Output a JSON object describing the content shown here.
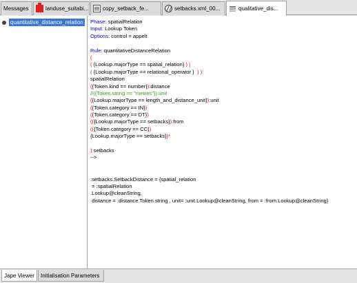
{
  "tabs": [
    {
      "label": "Messages",
      "icon": "none"
    },
    {
      "label": "landuse_suitabi...",
      "icon": "landuse-icon"
    },
    {
      "label": "copy_setback_fe...",
      "icon": "document-icon"
    },
    {
      "label": "setbacks.xml_00...",
      "icon": "xml-icon"
    },
    {
      "label": "qualitative_dis...",
      "icon": "jape-icon"
    }
  ],
  "tree": {
    "items": [
      {
        "label": "quantitative_distance_relation"
      }
    ]
  },
  "code_lines": [
    [
      {
        "t": "Phase: ",
        "c": "kw"
      },
      {
        "t": "spatialRelation",
        "c": "tx"
      }
    ],
    [
      {
        "t": "Input: ",
        "c": "kw"
      },
      {
        "t": "Lookup Token",
        "c": "tx"
      }
    ],
    [
      {
        "t": "Options: ",
        "c": "kw"
      },
      {
        "t": "control = appelt",
        "c": "tx"
      }
    ],
    [],
    [
      {
        "t": "Rule: ",
        "c": "kw"
      },
      {
        "t": "quantitativeDistanceRelation",
        "c": "tx"
      }
    ],
    [
      {
        "t": "(",
        "c": "red"
      }
    ],
    [
      {
        "t": "( ",
        "c": "red"
      },
      {
        "t": "{Lookup.majorType == spatial_relation}",
        "c": "tx"
      },
      {
        "t": " ) |",
        "c": "red"
      }
    ],
    [
      {
        "t": "( ",
        "c": "red"
      },
      {
        "t": "{Lookup.majorType == relational_operator }",
        "c": "tx"
      },
      {
        "t": "  ) ):",
        "c": "red"
      }
    ],
    [
      {
        "t": "spatialRelation",
        "c": "tx"
      }
    ],
    [
      {
        "t": "(",
        "c": "red"
      },
      {
        "t": "{Token.kind == number}",
        "c": "tx"
      },
      {
        "t": "):",
        "c": "red"
      },
      {
        "t": "distance",
        "c": "tx"
      }
    ],
    [
      {
        "t": "//({Token.string == \"metres\"}):unit",
        "c": "grn"
      }
    ],
    [
      {
        "t": "(",
        "c": "red"
      },
      {
        "t": "{Lookup.majorType == length_and_distance_unit}",
        "c": "tx"
      },
      {
        "t": "):",
        "c": "red"
      },
      {
        "t": "unit",
        "c": "tx"
      }
    ],
    [
      {
        "t": "(",
        "c": "red"
      },
      {
        "t": "{Token.category == IN}",
        "c": "tx"
      },
      {
        "t": ")",
        "c": "red"
      }
    ],
    [
      {
        "t": "(",
        "c": "red"
      },
      {
        "t": "{Token.category == DT}",
        "c": "tx"
      },
      {
        "t": ")",
        "c": "red"
      }
    ],
    [
      {
        "t": "(",
        "c": "red"
      },
      {
        "t": "(",
        "c": "red"
      },
      {
        "t": "{Lookup.majorType == setbacks}",
        "c": "tx"
      },
      {
        "t": "):",
        "c": "red"
      },
      {
        "t": "from",
        "c": "tx"
      }
    ],
    [
      {
        "t": "(",
        "c": "red"
      },
      {
        "t": "(",
        "c": "red"
      },
      {
        "t": "{Token.category == CC}",
        "c": "tx"
      },
      {
        "t": ")",
        "c": "red"
      }
    ],
    [
      {
        "t": "{Lookup.majorType == setbacks}",
        "c": "tx"
      },
      {
        "t": ")*",
        "c": "red"
      }
    ],
    [],
    [
      {
        "t": "):",
        "c": "red"
      },
      {
        "t": "setbacks",
        "c": "tx"
      }
    ],
    [
      {
        "t": "-->",
        "c": "tx"
      }
    ],
    [],
    [],
    [
      {
        "t": ":setbacks.SetbackDistance = {spatial_relation",
        "c": "tx"
      }
    ],
    [
      {
        "t": " = :spatialRelation",
        "c": "tx"
      }
    ],
    [
      {
        "t": ".Lookup@cleanString,",
        "c": "tx"
      }
    ],
    [
      {
        "t": " distance = :distance.Token.string , unit= :unit.Lookup@cleanString, from = :from.Lookup@cleanString}",
        "c": "tx"
      }
    ]
  ],
  "bottom_tabs": [
    {
      "label": "Jape Viewer"
    },
    {
      "label": "Initialisation Parameters"
    }
  ],
  "colors": {
    "keyword": "#0000e0",
    "paren": "#e00000",
    "comment": "#3a9a1a",
    "selection": "#3875d7"
  }
}
